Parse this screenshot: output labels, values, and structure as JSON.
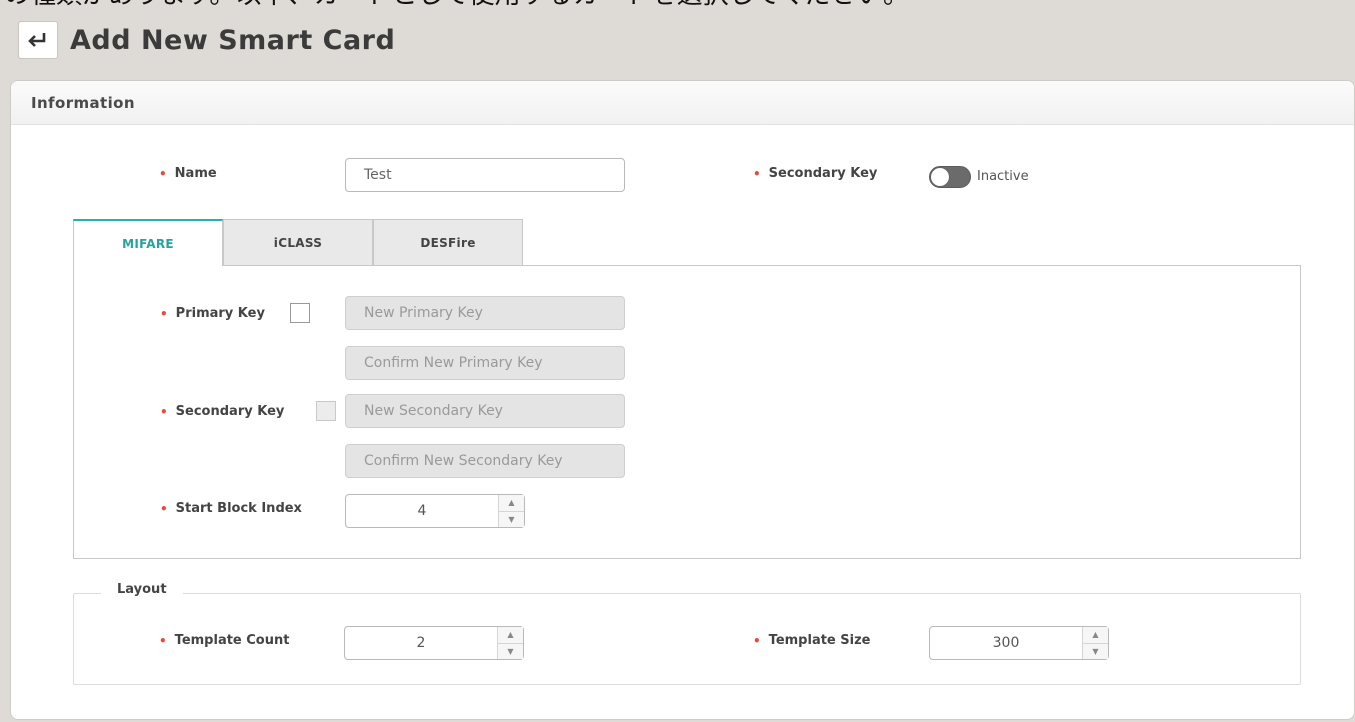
{
  "caption_fragment": "の種類があります。以下、カードとして使用するカードを選択してください。",
  "header": {
    "title": "Add New Smart Card",
    "back_icon": "return-arrow-icon"
  },
  "panel": {
    "title": "Information"
  },
  "name_field": {
    "label": "Name",
    "value": "Test"
  },
  "secondary_key_toggle": {
    "label": "Secondary Key",
    "state_text": "Inactive",
    "on": false
  },
  "tabs": [
    {
      "label": "MIFARE",
      "active": true
    },
    {
      "label": "iCLASS",
      "active": false
    },
    {
      "label": "DESFire",
      "active": false
    }
  ],
  "mifare": {
    "primary_key": {
      "label": "Primary Key",
      "checked": false,
      "new_placeholder": "New Primary Key",
      "confirm_placeholder": "Confirm New Primary Key"
    },
    "secondary_key": {
      "label": "Secondary Key",
      "checked": false,
      "disabled": true,
      "new_placeholder": "New Secondary Key",
      "confirm_placeholder": "Confirm New Secondary Key"
    },
    "start_block_index": {
      "label": "Start Block Index",
      "value": "4"
    }
  },
  "layout": {
    "legend": "Layout",
    "template_count": {
      "label": "Template Count",
      "value": "2"
    },
    "template_size": {
      "label": "Template Size",
      "value": "300"
    }
  },
  "colors": {
    "accent": "#26b1aa",
    "required_dot": "#e24d3b",
    "toggle_off": "#6b6b6b"
  }
}
